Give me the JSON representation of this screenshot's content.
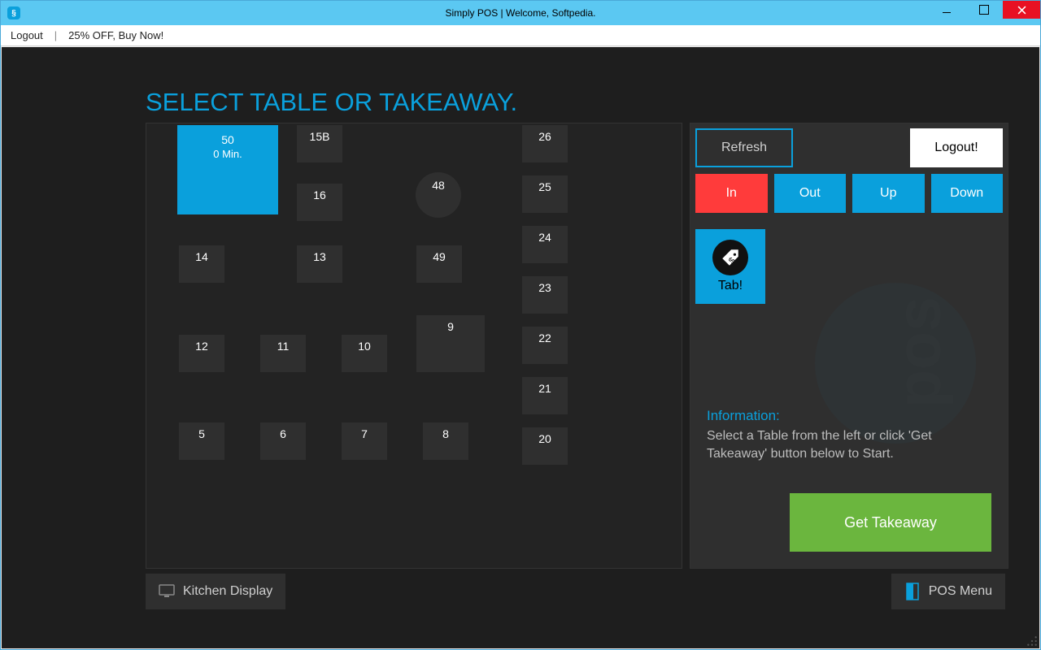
{
  "window": {
    "title": "Simply POS | Welcome, Softpedia."
  },
  "menubar": {
    "logout": "Logout",
    "sep": "|",
    "promo": "25% OFF, Buy Now!"
  },
  "page": {
    "title": "SELECT TABLE OR TAKEAWAY."
  },
  "tables": {
    "active": {
      "id": "50",
      "subtitle": "0 Min."
    },
    "t15b": "15B",
    "t16": "16",
    "t48": "48",
    "t14": "14",
    "t13": "13",
    "t49": "49",
    "t12": "12",
    "t11": "11",
    "t10": "10",
    "t9": "9",
    "t5": "5",
    "t6": "6",
    "t7": "7",
    "t8": "8",
    "t26": "26",
    "t25": "25",
    "t24": "24",
    "t23": "23",
    "t22": "22",
    "t21": "21",
    "t20": "20"
  },
  "side": {
    "refresh": "Refresh",
    "logout": "Logout!",
    "zoom": {
      "in": "In",
      "out": "Out",
      "up": "Up",
      "down": "Down"
    },
    "tab": "Tab!",
    "info_title": "Information:",
    "info_text": "Select a Table from the left or click 'Get Takeaway' button below to Start.",
    "takeaway": "Get Takeaway"
  },
  "footer": {
    "kitchen": "Kitchen Display",
    "pos_menu": "POS Menu"
  }
}
